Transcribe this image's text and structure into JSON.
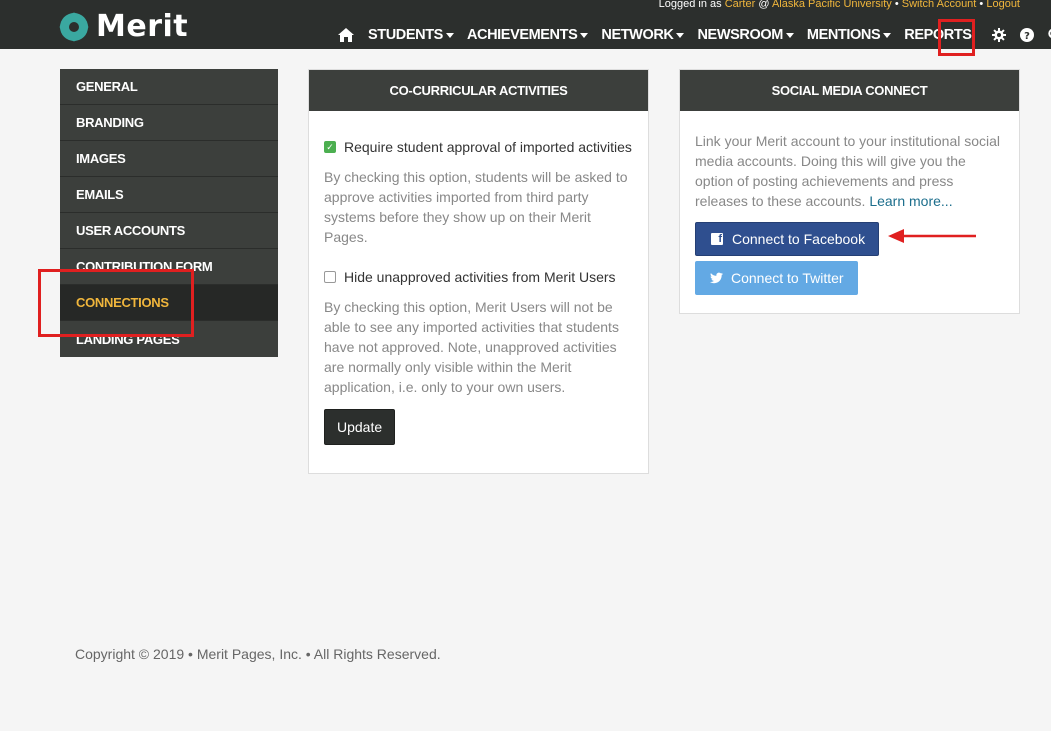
{
  "brand": {
    "name": "Merit"
  },
  "login": {
    "prefix": "Logged in as",
    "user": "Carter",
    "at": "@",
    "org": "Alaska Pacific University",
    "sep1": "•",
    "switch": "Switch Account",
    "sep2": "•",
    "logout": "Logout"
  },
  "nav": {
    "items": [
      {
        "label": "STUDENTS",
        "caret": true
      },
      {
        "label": "ACHIEVEMENTS",
        "caret": true
      },
      {
        "label": "NETWORK",
        "caret": true
      },
      {
        "label": "NEWSROOM",
        "caret": true
      },
      {
        "label": "MENTIONS",
        "caret": true
      },
      {
        "label": "REPORTS",
        "caret": false
      }
    ],
    "icons": [
      "home-icon",
      "gear-icon",
      "help-icon",
      "search-icon"
    ]
  },
  "sidebar": {
    "items": [
      {
        "label": "GENERAL"
      },
      {
        "label": "BRANDING"
      },
      {
        "label": "IMAGES"
      },
      {
        "label": "EMAILS"
      },
      {
        "label": "USER ACCOUNTS"
      },
      {
        "label": "CONTRIBUTION FORM"
      },
      {
        "label": "CONNECTIONS"
      },
      {
        "label": "LANDING PAGES"
      }
    ],
    "active": "CONNECTIONS"
  },
  "cocurricular": {
    "title": "CO-CURRICULAR ACTIVITIES",
    "option1_label": "Require student approval of imported activities",
    "option1_checked": true,
    "option1_desc": "By checking this option, students will be asked to approve activities imported from third party systems before they show up on their Merit Pages.",
    "option2_label": "Hide unapproved activities from Merit Users",
    "option2_checked": false,
    "option2_desc": "By checking this option, Merit Users will not be able to see any imported activities that students have not approved. Note, unapproved activities are normally only visible within the Merit application, i.e. only to your own users.",
    "update_label": "Update"
  },
  "social": {
    "title": "SOCIAL MEDIA CONNECT",
    "text": "Link your Merit account to your institutional social media accounts. Doing this will give you the option of posting achievements and press releases to these accounts.",
    "learn_more": "Learn more...",
    "facebook_label": "Connect to Facebook",
    "twitter_label": "Connect to Twitter"
  },
  "footer": {
    "text": "Copyright © 2019 • Merit Pages, Inc. • All Rights Reserved."
  },
  "colors": {
    "topbar": "#2c2f2d",
    "accent_yellow": "#f0b63c",
    "highlight_red": "#e02020",
    "facebook": "#2f4f8f",
    "twitter": "#63a9e4",
    "logo_teal": "#3aa8a0"
  }
}
